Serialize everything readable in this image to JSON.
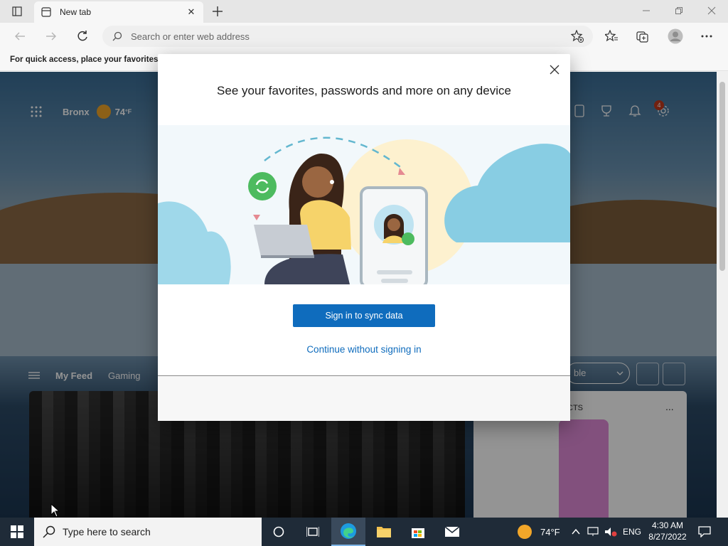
{
  "browser": {
    "tab_title": "New tab",
    "address_placeholder": "Search or enter web address",
    "favorites_hint": "For quick access, place your favorites h"
  },
  "newtab": {
    "city": "Bronx",
    "temperature": "74",
    "temperature_unit": "°F",
    "notification_count": "4",
    "feed_tabs": [
      "My Feed",
      "Gaming"
    ],
    "layout_label": "ble",
    "product_label": "CTS",
    "product_more": "..."
  },
  "modal": {
    "heading": "See your favorites, passwords and more on any device",
    "signin_button": "Sign in to sync data",
    "continue_link": "Continue without signing in"
  },
  "taskbar": {
    "search_placeholder": "Type here to search",
    "weather_temp": "74°F",
    "language": "ENG",
    "time": "4:30 AM",
    "date": "8/27/2022"
  },
  "colors": {
    "accent": "#0f6cbd",
    "taskbar": "#1f2b38",
    "notification_badge": "#c43a1d"
  }
}
